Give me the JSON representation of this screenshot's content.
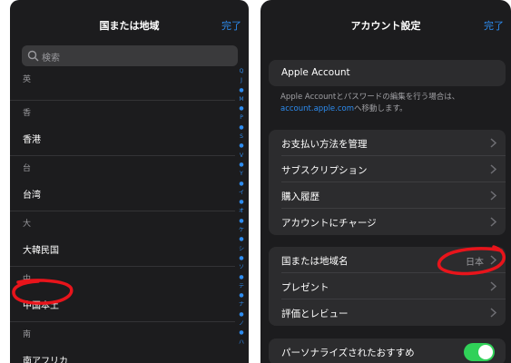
{
  "left": {
    "title": "国または地域",
    "done_label": "完了",
    "search_placeholder": "検索",
    "sections": [
      {
        "header": "英",
        "items": []
      },
      {
        "header": "香",
        "items": [
          "香港"
        ]
      },
      {
        "header": "台",
        "items": [
          "台湾"
        ]
      },
      {
        "header": "大",
        "items": [
          "大韓民国"
        ]
      },
      {
        "header": "中",
        "items": [
          "中国本土"
        ]
      },
      {
        "header": "南",
        "items": [
          "南アフリカ"
        ]
      }
    ],
    "index": [
      "Q",
      "J",
      "●",
      "M",
      "●",
      "P",
      "●",
      "S",
      "●",
      "V",
      "●",
      "Y",
      "●",
      "イ",
      "●",
      "オ",
      "●",
      "ケ",
      "●",
      "シ",
      "●",
      "ソ",
      "●",
      "テ",
      "●",
      "ナ",
      "●",
      "ノ",
      "●",
      "ハ"
    ]
  },
  "right": {
    "title": "アカウント設定",
    "done_label": "完了",
    "apple_account_label": "Apple Account",
    "footnote_text": "Apple Accountとパスワードの編集を行う場合は、",
    "footnote_link": "account.apple.com",
    "footnote_suffix": "へ移動します。",
    "group2": [
      "お支払い方法を管理",
      "サブスクリプション",
      "購入履歴",
      "アカウントにチャージ"
    ],
    "region_label": "国または地域名",
    "region_value": "日本",
    "gift_label": "プレゼント",
    "ratings_label": "評価とレビュー",
    "personalize_label": "パーソナライズされたおすすめ"
  },
  "colors": {
    "accent": "#2d8cf0",
    "toggle_on": "#30d158",
    "annotation": "#e8141b"
  }
}
